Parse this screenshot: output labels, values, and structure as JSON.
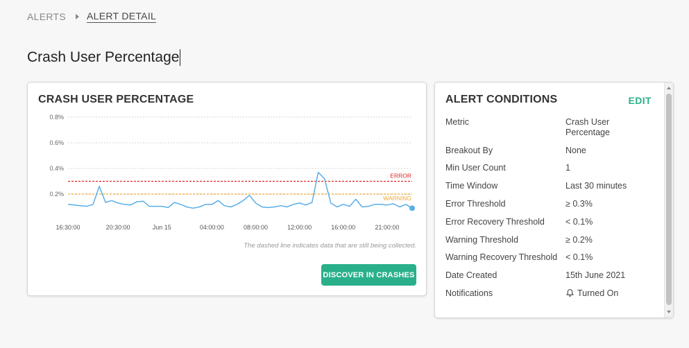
{
  "breadcrumb": {
    "parent": "ALERTS",
    "current": "ALERT DETAIL"
  },
  "page": {
    "title": "Crash User Percentage"
  },
  "chart_card": {
    "title": "CRASH USER PERCENTAGE",
    "note": "The dashed line indicates data that are still being collected.",
    "discover_button": "DISCOVER IN CRASHES"
  },
  "chart_data": {
    "type": "line",
    "title": "",
    "xlabel": "",
    "ylabel": "",
    "ylim": [
      0.0,
      0.9
    ],
    "yticks": [
      {
        "value": 0.2,
        "label": "0.2%"
      },
      {
        "value": 0.4,
        "label": "0.4%"
      },
      {
        "value": 0.6,
        "label": "0.6%"
      },
      {
        "value": 0.8,
        "label": "0.8%"
      }
    ],
    "xticks": [
      {
        "index": 0,
        "label": "16:30:00"
      },
      {
        "index": 8,
        "label": "20:30:00"
      },
      {
        "index": 15,
        "label": "Jun 15"
      },
      {
        "index": 23,
        "label": "04:00:00"
      },
      {
        "index": 30,
        "label": "08:00:00"
      },
      {
        "index": 37,
        "label": "12:00:00"
      },
      {
        "index": 44,
        "label": "16:00:00"
      },
      {
        "index": 51,
        "label": "21:00:00"
      }
    ],
    "grid": true,
    "thresholds": [
      {
        "name": "ERROR",
        "value": 0.3,
        "color": "#e02020"
      },
      {
        "name": "WARNING",
        "value": 0.2,
        "color": "#f0a830"
      }
    ],
    "series": [
      {
        "color": "#5aaee8",
        "values": [
          0.12,
          0.115,
          0.11,
          0.105,
          0.12,
          0.26,
          0.135,
          0.15,
          0.13,
          0.12,
          0.115,
          0.14,
          0.145,
          0.105,
          0.105,
          0.105,
          0.095,
          0.135,
          0.12,
          0.1,
          0.09,
          0.1,
          0.12,
          0.12,
          0.15,
          0.11,
          0.1,
          0.12,
          0.15,
          0.19,
          0.13,
          0.1,
          0.095,
          0.1,
          0.11,
          0.1,
          0.12,
          0.13,
          0.115,
          0.135,
          0.37,
          0.32,
          0.13,
          0.1,
          0.12,
          0.105,
          0.16,
          0.1,
          0.105,
          0.12,
          0.12,
          0.115,
          0.125,
          0.1,
          0.12,
          0.09
        ]
      }
    ]
  },
  "conditions_card": {
    "title": "ALERT CONDITIONS",
    "edit_label": "EDIT",
    "rows": [
      {
        "label": "Metric",
        "value": "Crash User Percentage"
      },
      {
        "label": "Breakout By",
        "value": "None"
      },
      {
        "label": "Min User Count",
        "value": "1"
      },
      {
        "label": "Time Window",
        "value": "Last 30 minutes"
      },
      {
        "label": "Error Threshold",
        "value": "≥ 0.3%"
      },
      {
        "label": "Error Recovery Threshold",
        "value": "< 0.1%"
      },
      {
        "label": "Warning Threshold",
        "value": "≥ 0.2%"
      },
      {
        "label": "Warning Recovery Threshold",
        "value": "< 0.1%"
      },
      {
        "label": "Date Created",
        "value": "15th June 2021"
      },
      {
        "label": "Notifications",
        "value": "Turned On",
        "icon": "bell-icon"
      }
    ]
  },
  "colors": {
    "accent": "#29b08a",
    "line": "#5aaee8",
    "error": "#e02020",
    "warning": "#f0a830"
  }
}
